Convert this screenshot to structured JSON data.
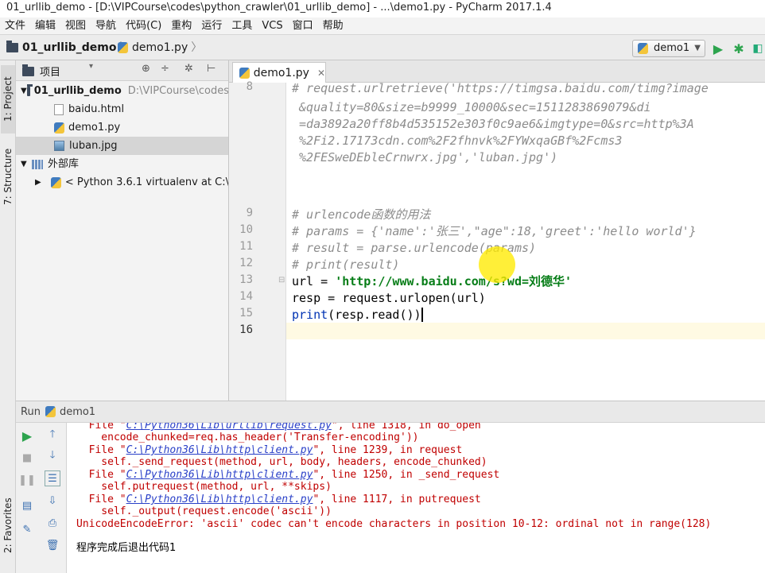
{
  "titlebar": {
    "title": "01_urllib_demo - [D:\\VIPCourse\\codes\\python_crawler\\01_urllib_demo] - ...\\demo1.py - PyCharm 2017.1.4"
  },
  "menu": [
    "文件",
    "编辑",
    "视图",
    "导航",
    "代码(C)",
    "重构",
    "运行",
    "工具",
    "VCS",
    "窗口",
    "帮助"
  ],
  "breadcrumb": {
    "project": "01_urllib_demo",
    "file": "demo1.py"
  },
  "run_config": "demo1",
  "left_strip": {
    "project_tab": "1: Project",
    "structure_tab": "7: Structure",
    "favorites_tab": "2: Favorites"
  },
  "project_panel": {
    "header": "项目",
    "root": {
      "name": "01_urllib_demo",
      "path": "D:\\VIPCourse\\codes"
    },
    "files": [
      "baidu.html",
      "demo1.py",
      "luban.jpg"
    ],
    "ext_libs": "外部库",
    "interpreter": "< Python 3.6.1 virtualenv at C:\\"
  },
  "editor": {
    "tab_label": "demo1.py",
    "line_numbers": [
      "8",
      "9",
      "10",
      "11",
      "12",
      "13",
      "14",
      "15",
      "16"
    ],
    "code": {
      "l8a": "# request.urlretrieve('https://timgsa.baidu.com/timg?image",
      "l8b": " &quality=80&size=b9999_10000&sec=1511283869079&di",
      "l8c": " =da3892a20ff8b4d535152e303f0c9ae6&imgtype=0&src=http%3A",
      "l8d": " %2Fi2.17173cdn.com%2F2fhnvk%2FYWxqaGBf%2Fcms3",
      "l8e": " %2FESweDEbleCrnwrx.jpg','luban.jpg')",
      "l10": "# urlencode函数的用法",
      "l11": "# params = {'name':'张三',\"age\":18,'greet':'hello world'}",
      "l12": "# result = parse.urlencode(params)",
      "l13": "# print(result)",
      "l14_pre": "url = ",
      "l14_str": "'http://www.baidu.com/s?wd=刘德华'",
      "l15": "resp = request.urlopen(url)",
      "l16_kw": "print",
      "l16_rest": "(resp.read())"
    }
  },
  "run_panel": {
    "label": "Run",
    "config": "demo1",
    "output": {
      "f1_pre": "  File \"",
      "f1_link": "C:\\Python36\\Lib\\urllib\\request.py",
      "f1_post": "\", line 1318, in do_open",
      "c1": "    encode_chunked=req.has_header('Transfer-encoding'))",
      "f2_pre": "  File \"",
      "f2_link": "C:\\Python36\\Lib\\http\\client.py",
      "f2_post": "\", line 1239, in request",
      "c2": "    self._send_request(method, url, body, headers, encode_chunked)",
      "f3_pre": "  File \"",
      "f3_link": "C:\\Python36\\Lib\\http\\client.py",
      "f3_post": "\", line 1250, in _send_request",
      "c3": "    self.putrequest(method, url, **skips)",
      "f4_pre": "  File \"",
      "f4_link": "C:\\Python36\\Lib\\http\\client.py",
      "f4_post": "\", line 1117, in putrequest",
      "c4": "    self._output(request.encode('ascii'))",
      "err": "UnicodeEncodeError: 'ascii' codec can't encode characters in position 10-12: ordinal not in range(128)",
      "exit": "程序完成后退出代码1"
    }
  },
  "colors": {
    "string": "#067d17",
    "keyword": "#0033b3",
    "comment": "#8c8c8c",
    "error": "#c00000",
    "link": "#2a40c8",
    "run_green": "#2da44e"
  }
}
